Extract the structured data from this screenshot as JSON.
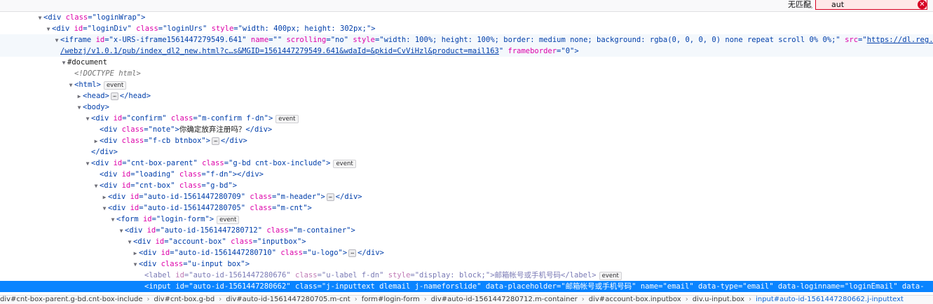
{
  "search": {
    "status": "无匹配",
    "value": "aut"
  },
  "lines": [
    {
      "indent": 64,
      "tw": "▼",
      "html": "<span class='tag'>&lt;div </span><span class='attr'>class</span><span class='tag'>=\"</span><span class='val'>loginWrap</span><span class='tag'>\"&gt;</span>"
    },
    {
      "indent": 76,
      "tw": "▼",
      "html": "<span class='tag'>&lt;div </span><span class='attr'>id</span><span class='tag'>=\"</span><span class='val'>loginDiv</span><span class='tag'>\" </span><span class='attr'>class</span><span class='tag'>=\"</span><span class='val'>loginUrs</span><span class='tag'>\" </span><span class='attr'>style</span><span class='tag'>=\"</span><span class='val'>width: 400px; height: 302px;</span><span class='tag'>\"&gt;</span>"
    },
    {
      "indent": 88,
      "tw": "▼",
      "shade": true,
      "html": "<span class='tag'>&lt;iframe </span><span class='attr'>id</span><span class='tag'>=\"</span><span class='val'>x-URS-iframe1561447279549.641</span><span class='tag'>\" </span><span class='attr'>name</span><span class='tag'>=\"\" </span><span class='attr'>scrolling</span><span class='tag'>=\"</span><span class='val'>no</span><span class='tag'>\" </span><span class='attr'>style</span><span class='tag'>=\"</span><span class='val'>width: 100%; height: 100%; border: medium none; background: rgba(0, 0, 0, 0) none repeat scroll 0% 0%;</span><span class='tag'>\" </span><span class='attr'>src</span><span class='tag'>=\"</span><span class='link'>https://dl.reg.163.com</span>"
    },
    {
      "indent": 88,
      "tw": "",
      "shade": true,
      "html": "<span class='link'>/webzj/v1.0.1/pub/index_dl2_new.html?c…s&amp;MGID=1561447279549.641&amp;wdaId=&amp;pkid=CvViHzl&amp;product=mail163</span><span class='tag'>\" </span><span class='attr'>frameborder</span><span class='tag'>=\"</span><span class='val'>0</span><span class='tag'>\"&gt;</span>"
    },
    {
      "indent": 98,
      "tw": "▼",
      "html": "<span class='text'>#document</span>"
    },
    {
      "indent": 108,
      "tw": "",
      "html": "<span class='doctype'>&lt;!DOCTYPE html&gt;</span>"
    },
    {
      "indent": 108,
      "tw": "▼",
      "html": "<span class='tag'>&lt;html&gt;</span><span class='badge'>event</span>"
    },
    {
      "indent": 120,
      "tw": "▶",
      "html": "<span class='tag'>&lt;head&gt;</span><span class='ellipsis'>⋯</span><span class='tag'>&lt;/head&gt;</span>"
    },
    {
      "indent": 120,
      "tw": "▼",
      "html": "<span class='tag'>&lt;body&gt;</span>"
    },
    {
      "indent": 132,
      "tw": "▼",
      "html": "<span class='tag'>&lt;div </span><span class='attr'>id</span><span class='tag'>=\"</span><span class='val'>confirm</span><span class='tag'>\" </span><span class='attr'>class</span><span class='tag'>=\"</span><span class='val'>m-confirm f-dn</span><span class='tag'>\"&gt;</span><span class='badge'>event</span>"
    },
    {
      "indent": 144,
      "tw": "",
      "html": "<span class='tag'>&lt;div </span><span class='attr'>class</span><span class='tag'>=\"</span><span class='val'>note</span><span class='tag'>\"&gt;</span><span class='text'>你确定放弃注册吗？</span><span class='tag'>&lt;/div&gt;</span>"
    },
    {
      "indent": 144,
      "tw": "▶",
      "html": "<span class='tag'>&lt;div </span><span class='attr'>class</span><span class='tag'>=\"</span><span class='val'>f-cb btnbox</span><span class='tag'>\"&gt;</span><span class='ellipsis'>⋯</span><span class='tag'>&lt;/div&gt;</span>"
    },
    {
      "indent": 132,
      "tw": "",
      "html": "<span class='tag'>&lt;/div&gt;</span>"
    },
    {
      "indent": 132,
      "tw": "▼",
      "html": "<span class='tag'>&lt;div </span><span class='attr'>id</span><span class='tag'>=\"</span><span class='val'>cnt-box-parent</span><span class='tag'>\" </span><span class='attr'>class</span><span class='tag'>=\"</span><span class='val'>g-bd cnt-box-include</span><span class='tag'>\"&gt;</span><span class='badge'>event</span>"
    },
    {
      "indent": 144,
      "tw": "",
      "html": "<span class='tag'>&lt;div </span><span class='attr'>id</span><span class='tag'>=\"</span><span class='val'>loading</span><span class='tag'>\" </span><span class='attr'>class</span><span class='tag'>=\"</span><span class='val'>f-dn</span><span class='tag'>\"&gt;&lt;/div&gt;</span>"
    },
    {
      "indent": 144,
      "tw": "▼",
      "html": "<span class='tag'>&lt;div </span><span class='attr'>id</span><span class='tag'>=\"</span><span class='val'>cnt-box</span><span class='tag'>\" </span><span class='attr'>class</span><span class='tag'>=\"</span><span class='val'>g-bd</span><span class='tag'>\"&gt;</span>"
    },
    {
      "indent": 156,
      "tw": "▶",
      "html": "<span class='tag'>&lt;div </span><span class='attr'>id</span><span class='tag'>=\"</span><span class='val'>auto-id-1561447280709</span><span class='tag'>\" </span><span class='attr'>class</span><span class='tag'>=\"</span><span class='val'>m-header</span><span class='tag'>\"&gt;</span><span class='ellipsis'>⋯</span><span class='tag'>&lt;/div&gt;</span>"
    },
    {
      "indent": 156,
      "tw": "▼",
      "html": "<span class='tag'>&lt;div </span><span class='attr'>id</span><span class='tag'>=\"</span><span class='val'>auto-id-1561447280705</span><span class='tag'>\" </span><span class='attr'>class</span><span class='tag'>=\"</span><span class='val'>m-cnt</span><span class='tag'>\"&gt;</span>"
    },
    {
      "indent": 168,
      "tw": "▼",
      "html": "<span class='tag'>&lt;form </span><span class='attr'>id</span><span class='tag'>=\"</span><span class='val'>login-form</span><span class='tag'>\"&gt;</span><span class='badge'>event</span>"
    },
    {
      "indent": 180,
      "tw": "▼",
      "html": "<span class='tag'>&lt;div </span><span class='attr'>id</span><span class='tag'>=\"</span><span class='val'>auto-id-1561447280712</span><span class='tag'>\" </span><span class='attr'>class</span><span class='tag'>=\"</span><span class='val'>m-container</span><span class='tag'>\"&gt;</span>"
    },
    {
      "indent": 192,
      "tw": "▼",
      "html": "<span class='tag'>&lt;div </span><span class='attr'>id</span><span class='tag'>=\"</span><span class='val'>account-box</span><span class='tag'>\" </span><span class='attr'>class</span><span class='tag'>=\"</span><span class='val'>inputbox</span><span class='tag'>\"&gt;</span>"
    },
    {
      "indent": 200,
      "tw": "▶",
      "html": "<span class='tag'>&lt;div </span><span class='attr'>id</span><span class='tag'>=\"</span><span class='val'>auto-id-1561447280710</span><span class='tag'>\" </span><span class='attr'>class</span><span class='tag'>=\"</span><span class='val'>u-logo</span><span class='tag'>\"&gt;</span><span class='ellipsis'>⋯</span><span class='tag'>&lt;/div&gt;</span>"
    },
    {
      "indent": 200,
      "tw": "▼",
      "html": "<span class='tag'>&lt;div </span><span class='attr'>class</span><span class='tag'>=\"</span><span class='val'>u-input box</span><span class='tag'>\"&gt;</span>"
    },
    {
      "indent": 208,
      "tw": "",
      "html": "<span class='tag' style='color:#7a7ab5'>&lt;label </span><span class='attr' style='color:#c07ab5'>id</span><span class='tag' style='color:#7a7ab5'>=\"</span><span class='val' style='color:#7a7ab5'>auto-id-1561447280676</span><span class='tag' style='color:#7a7ab5'>\" </span><span class='attr' style='color:#c07ab5'>class</span><span class='tag' style='color:#7a7ab5'>=\"</span><span class='val' style='color:#7a7ab5'>u-label f-dn</span><span class='tag' style='color:#7a7ab5'>\" </span><span class='attr' style='color:#c07ab5'>style</span><span class='tag' style='color:#7a7ab5'>=\"</span><span class='val' style='color:#7a7ab5'>display: block;</span><span class='tag' style='color:#7a7ab5'>\"&gt;</span><span class='text' style='color:#7a7ab5'>邮箱帐号或手机号码</span><span class='tag' style='color:#7a7ab5'>&lt;/label&gt;</span><span class='badge'>event</span>"
    },
    {
      "indent": 208,
      "tw": "",
      "selected": true,
      "html": "<span class='tag'>&lt;input </span><span class='attr'>id</span><span class='tag'>=\"</span><span class='val'>auto-id-1561447280662</span><span class='tag'>\" </span><span class='attr'>class</span><span class='tag'>=\"</span><span class='val'>j-inputtext dlemail j-nameforslide</span><span class='tag'>\" </span><span class='attr'>data-placeholder</span><span class='tag'>=\"</span><span class='val'>邮箱帐号或手机号码</span><span class='tag'>\" </span><span class='attr'>name</span><span class='tag'>=\"</span><span class='val'>email</span><span class='tag'>\" </span><span class='attr'>data-type</span><span class='tag'>=\"</span><span class='val'>email</span><span class='tag'>\" </span><span class='attr'>data-loginname</span><span class='tag'>=\"</span><span class='val'>loginEmail</span><span class='tag'>\" </span><span class='attr'>data-</span>"
    }
  ],
  "breadcrumbs": [
    "div#cnt-box-parent.g-bd.cnt-box-include",
    "div#cnt-box.g-bd",
    "div#auto-id-1561447280705.m-cnt",
    "form#login-form",
    "div#auto-id-1561447280712.m-container",
    "div#account-box.inputbox",
    "div.u-input.box",
    "input#auto-id-1561447280662.j-inputtext"
  ]
}
